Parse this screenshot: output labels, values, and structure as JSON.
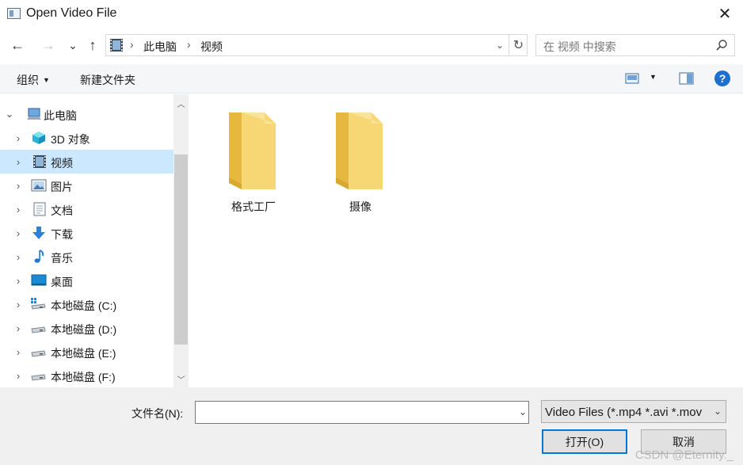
{
  "window": {
    "title": "Open Video File",
    "close_glyph": "✕"
  },
  "nav": {
    "back_glyph": "←",
    "forward_glyph": "→",
    "recent_glyph": "⌄",
    "up_glyph": "↑"
  },
  "address": {
    "crumbs": [
      "此电脑",
      "视频"
    ],
    "refresh_glyph": "↻",
    "dropdown_glyph": "⌄"
  },
  "search": {
    "placeholder": "在 视频 中搜索"
  },
  "commands": {
    "organize": "组织",
    "new_folder": "新建文件夹",
    "help": "?"
  },
  "sidebar": {
    "root": {
      "label": "此电脑",
      "icon": "computer-icon"
    },
    "items": [
      {
        "label": "3D 对象",
        "icon": "cube-icon",
        "selected": false
      },
      {
        "label": "视频",
        "icon": "film-icon",
        "selected": true
      },
      {
        "label": "图片",
        "icon": "picture-icon",
        "selected": false
      },
      {
        "label": "文档",
        "icon": "document-icon",
        "selected": false
      },
      {
        "label": "下载",
        "icon": "download-icon",
        "selected": false
      },
      {
        "label": "音乐",
        "icon": "music-icon",
        "selected": false
      },
      {
        "label": "桌面",
        "icon": "desktop-icon",
        "selected": false
      },
      {
        "label": "本地磁盘 (C:)",
        "icon": "system-drive-icon",
        "selected": false
      },
      {
        "label": "本地磁盘 (D:)",
        "icon": "drive-icon",
        "selected": false
      },
      {
        "label": "本地磁盘 (E:)",
        "icon": "drive-icon",
        "selected": false
      },
      {
        "label": "本地磁盘 (F:)",
        "icon": "drive-icon",
        "selected": false
      }
    ]
  },
  "files": [
    {
      "name": "格式工厂",
      "icon": "folder-icon"
    },
    {
      "name": "摄像",
      "icon": "folder-icon"
    }
  ],
  "footer": {
    "filename_label": "文件名(N):",
    "filename_value": "",
    "filetype_value": "Video Files (*.mp4 *.avi *.mov",
    "open_label": "打开(O)",
    "cancel_label": "取消"
  },
  "watermark": "CSDN @Eternity._",
  "colors": {
    "accent": "#0078d7",
    "selection": "#cce8ff",
    "folder": "#f7d774",
    "help": "#1f6fcc"
  }
}
